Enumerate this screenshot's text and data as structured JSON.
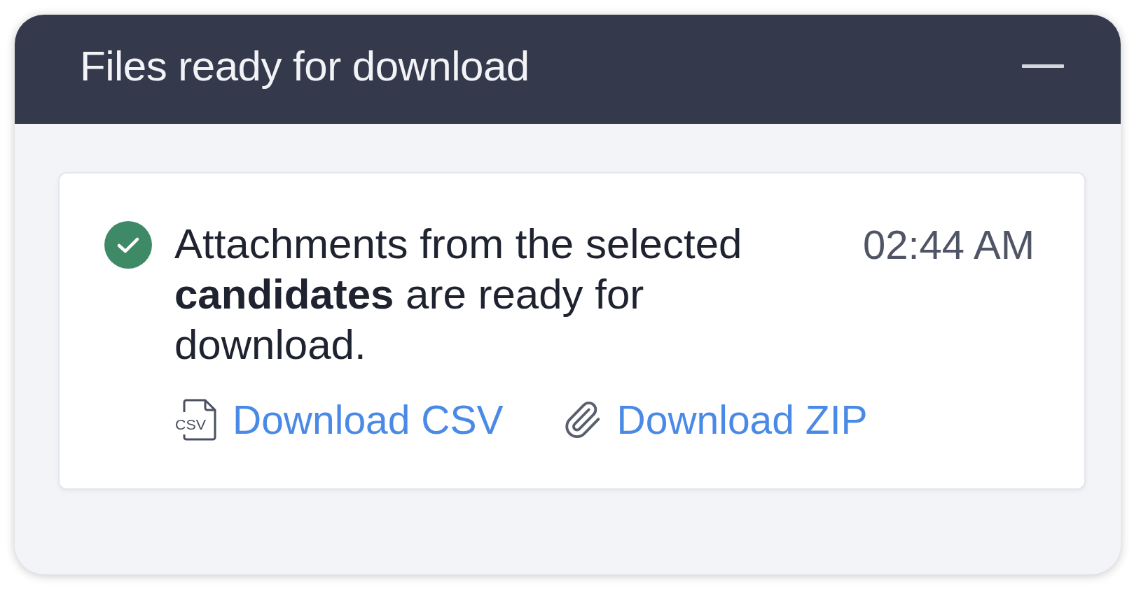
{
  "window": {
    "title": "Files ready for download"
  },
  "notification": {
    "completed": true,
    "message": "Attachments from the selected **candidates** are ready for download.",
    "time": "02:44 AM",
    "actions": [
      {
        "kind": "csv",
        "label": "Download CSV",
        "icon_text": "CSV"
      },
      {
        "kind": "zip",
        "label": "Download ZIP"
      }
    ]
  }
}
